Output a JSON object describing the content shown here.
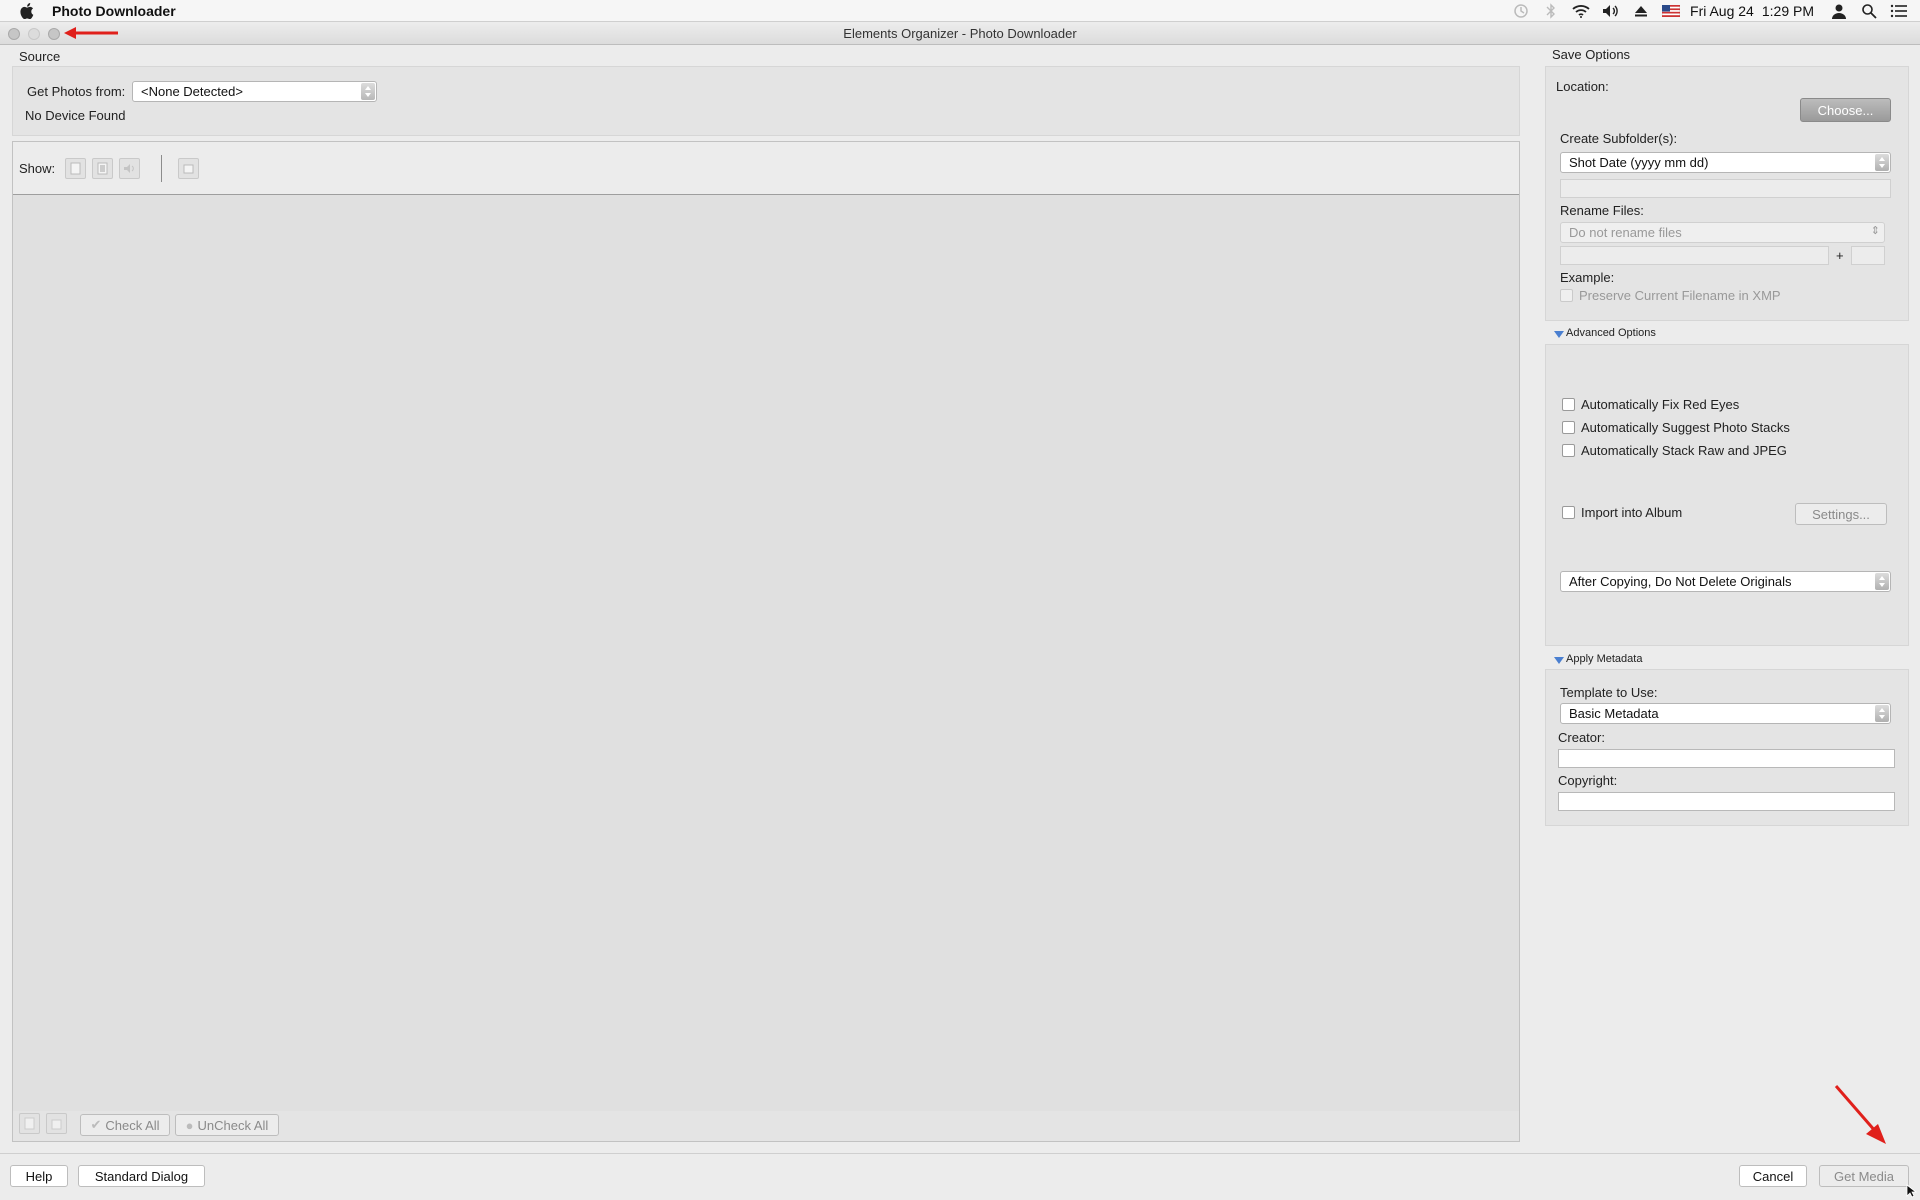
{
  "menubar": {
    "app_name": "Photo Downloader",
    "date": "Fri Aug 24",
    "time": "1:29 PM",
    "icons": [
      "apple-icon",
      "time-machine-icon",
      "bluetooth-icon",
      "wifi-icon",
      "volume-icon",
      "eject-icon",
      "flag-icon",
      "user-icon",
      "search-icon",
      "list-icon"
    ]
  },
  "window": {
    "title": "Elements Organizer - Photo Downloader"
  },
  "source": {
    "section_label": "Source",
    "get_photos_label": "Get Photos from:",
    "get_photos_value": "<None Detected>",
    "status": "No Device Found"
  },
  "media": {
    "show_label": "Show:",
    "check_all": "Check All",
    "uncheck_all": "UnCheck All"
  },
  "save_options": {
    "section_label": "Save Options",
    "location_label": "Location:",
    "choose_button": "Choose...",
    "create_subfolders_label": "Create Subfolder(s):",
    "create_subfolders_value": "Shot Date (yyyy mm dd)",
    "rename_files_label": "Rename Files:",
    "rename_files_value": "Do not rename files",
    "plus": "+",
    "example_label": "Example:",
    "preserve_label": "Preserve Current Filename in XMP"
  },
  "advanced": {
    "section_label": "Advanced Options",
    "fix_red_eyes": "Automatically Fix Red Eyes",
    "suggest_stacks": "Automatically Suggest Photo Stacks",
    "stack_raw_jpeg": "Automatically Stack Raw and JPEG",
    "import_album": "Import into Album",
    "settings_button": "Settings...",
    "after_copying_value": "After Copying, Do Not Delete Originals"
  },
  "metadata": {
    "section_label": "Apply Metadata",
    "template_label": "Template to Use:",
    "template_value": "Basic Metadata",
    "creator_label": "Creator:",
    "copyright_label": "Copyright:"
  },
  "footer": {
    "help": "Help",
    "standard_dialog": "Standard Dialog",
    "cancel": "Cancel",
    "get_media": "Get Media"
  },
  "colors": {
    "annotation_red": "#e0201b",
    "select_accent": "#3a82e6"
  }
}
